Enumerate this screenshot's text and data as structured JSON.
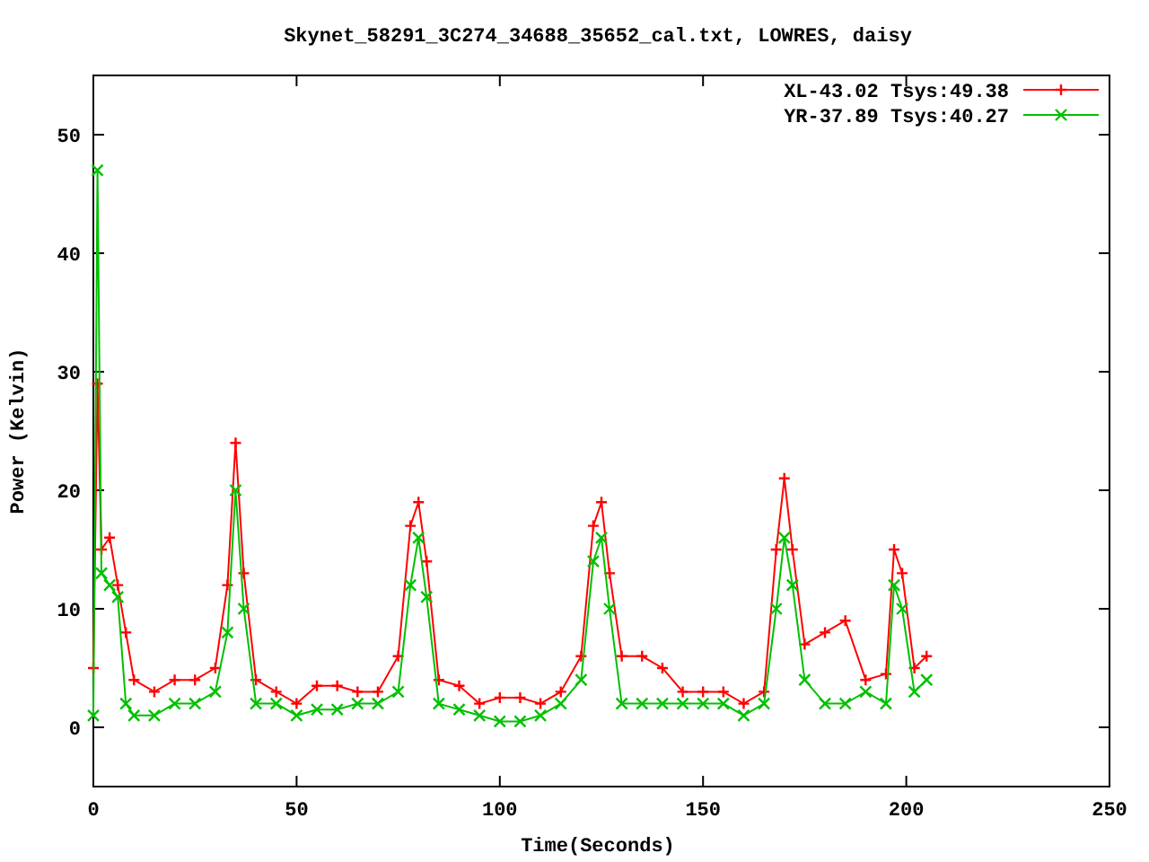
{
  "chart_data": {
    "type": "line",
    "title": "Skynet_58291_3C274_34688_35652_cal.txt, LOWRES, daisy",
    "xlabel": "Time(Seconds)",
    "ylabel": "Power (Kelvin)",
    "x": [
      0,
      1,
      2,
      4,
      6,
      8,
      10,
      15,
      20,
      25,
      30,
      33,
      35,
      37,
      40,
      45,
      50,
      55,
      60,
      65,
      70,
      75,
      78,
      80,
      82,
      85,
      90,
      95,
      100,
      105,
      110,
      115,
      120,
      123,
      125,
      127,
      130,
      135,
      140,
      145,
      150,
      155,
      160,
      165,
      168,
      170,
      172,
      175,
      180,
      185,
      190,
      195,
      197,
      199,
      202,
      205
    ],
    "series": [
      {
        "name": "XL-43.02 Tsys:49.38",
        "color": "#ff0000",
        "marker": "plus",
        "values": [
          5,
          29,
          15,
          16,
          12,
          8,
          4,
          3,
          4,
          4,
          5,
          12,
          24,
          13,
          4,
          3,
          2,
          3.5,
          3.5,
          3,
          3,
          6,
          17,
          19,
          14,
          4,
          3.5,
          2,
          2.5,
          2.5,
          2,
          3,
          6,
          17,
          19,
          13,
          6,
          6,
          5,
          3,
          3,
          3,
          2,
          3,
          15,
          21,
          15,
          7,
          8,
          9,
          4,
          4.5,
          15,
          13,
          5,
          6
        ]
      },
      {
        "name": "YR-37.89 Tsys:40.27",
        "color": "#00c000",
        "marker": "cross",
        "values": [
          1,
          47,
          13,
          12,
          11,
          2,
          1,
          1,
          2,
          2,
          3,
          8,
          20,
          10,
          2,
          2,
          1,
          1.5,
          1.5,
          2,
          2,
          3,
          12,
          16,
          11,
          2,
          1.5,
          1,
          0.5,
          0.5,
          1,
          2,
          4,
          14,
          16,
          10,
          2,
          2,
          2,
          2,
          2,
          2,
          1,
          2,
          10,
          16,
          12,
          4,
          2,
          2,
          3,
          2,
          12,
          10,
          3,
          4
        ]
      }
    ],
    "xlim": [
      0,
      250
    ],
    "ylim": [
      -5,
      55
    ],
    "xticks": [
      0,
      50,
      100,
      150,
      200,
      250
    ],
    "yticks": [
      0,
      10,
      20,
      30,
      40,
      50
    ],
    "legend": "top-right"
  }
}
